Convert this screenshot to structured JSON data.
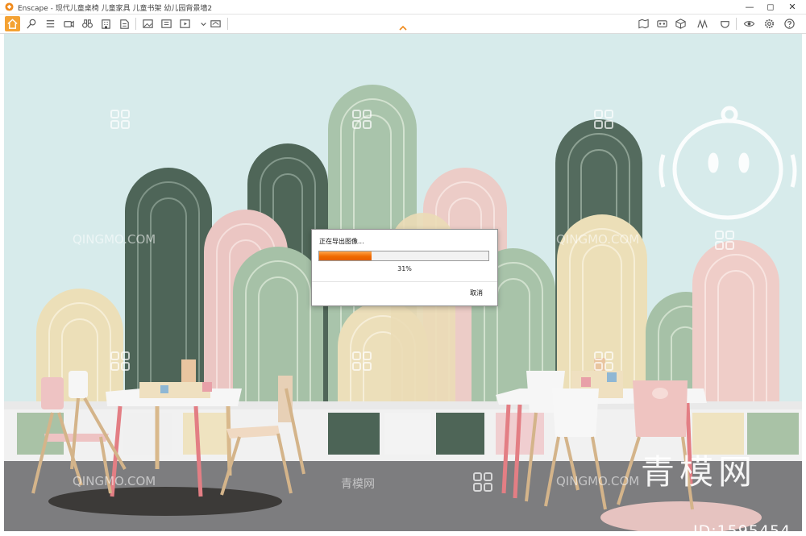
{
  "window": {
    "app_name": "Enscape",
    "title": "Enscape - 现代儿童桌椅 儿童家具 儿童书架 幼儿园背景墙2",
    "controls": [
      "minimize",
      "maximize",
      "close"
    ]
  },
  "toolbar": {
    "left_icons": [
      "home-icon",
      "pin-icon",
      "list-icon",
      "video-path-icon",
      "binoculars-icon",
      "building-icon",
      "book-icon",
      "clipboard-icon",
      "capture-image-icon",
      "batch-render-icon",
      "export-video-icon",
      "export-panorama-icon"
    ],
    "right_icons": [
      "map-icon",
      "vr-icon",
      "cube-icon",
      "asset-library-icon",
      "material-icon",
      "view-settings-icon",
      "settings-icon",
      "help-icon"
    ],
    "accent_color": "#f4a233"
  },
  "export_dialog": {
    "title": "正在导出图像...",
    "progress_fraction": 0.31,
    "progress_text": "31%",
    "cancel_label": "取消",
    "bar_color": "#f06a00"
  },
  "watermarks": {
    "site_latin": "QINGMO.COM",
    "site_cn": "青模网",
    "big_text": "青模网",
    "id_text": "ID:1595454"
  }
}
